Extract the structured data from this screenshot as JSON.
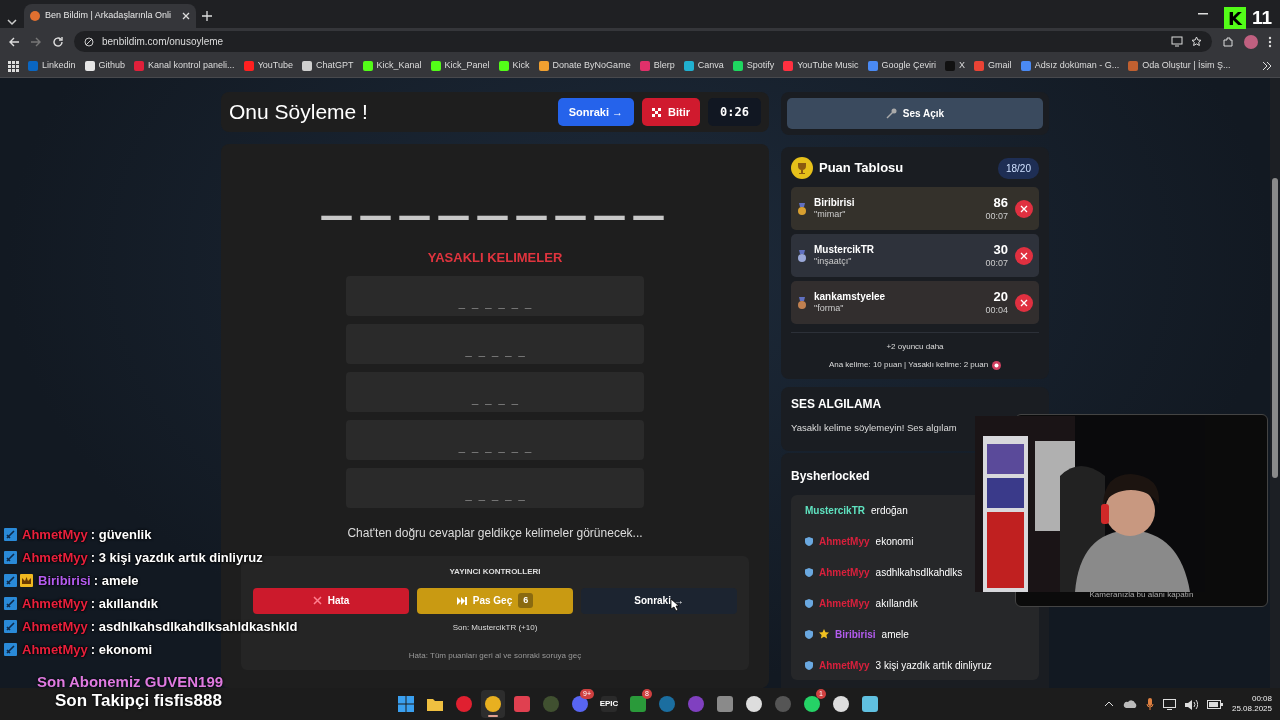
{
  "browser": {
    "tab": {
      "title": "Ben Bildim | Arkadaşlarınla Onli",
      "selected": true
    },
    "url": "benbildim.com/onusoyleme",
    "bookmarks": [
      {
        "label": "Linkedin",
        "color": "#0a66c2"
      },
      {
        "label": "Github",
        "color": "#e6e6e6"
      },
      {
        "label": "Kanal kontrol paneli...",
        "color": "#e0203a"
      },
      {
        "label": "YouTube",
        "color": "#ff2020"
      },
      {
        "label": "ChatGPT",
        "color": "#cfcfcf"
      },
      {
        "label": "Kick_Kanal",
        "color": "#53fc18"
      },
      {
        "label": "Kick_Panel",
        "color": "#53fc18"
      },
      {
        "label": "Kick",
        "color": "#53fc18"
      },
      {
        "label": "Donate ByNoGame",
        "color": "#f0a030"
      },
      {
        "label": "Blerp",
        "color": "#e0306a"
      },
      {
        "label": "Canva",
        "color": "#20b0d0"
      },
      {
        "label": "Spotify",
        "color": "#1ed760"
      },
      {
        "label": "YouTube Music",
        "color": "#ff3040"
      },
      {
        "label": "Google Çeviri",
        "color": "#4a8af4"
      },
      {
        "label": "X",
        "color": "#111111"
      },
      {
        "label": "Gmail",
        "color": "#ea4335"
      },
      {
        "label": "Adsız doküman - G...",
        "color": "#4a8af4"
      },
      {
        "label": "Oda Oluştur | İsim Ş...",
        "color": "#c06030"
      }
    ]
  },
  "kick_widget": {
    "logo": "K",
    "count": "11"
  },
  "game": {
    "title": "Onu Söyleme !",
    "next_button": "Sonraki →",
    "end_button": "Bitir",
    "timer": "0:26",
    "word_mask": "—————————",
    "banned_title": "YASAKLI KELIMELER",
    "banned_words": [
      "_ _ _ _ _ _",
      "_ _ _ _ _",
      "_ _ _ _",
      "_ _ _ _ _ _",
      "_ _ _ _ _"
    ],
    "hint": "Chat'ten doğru cevaplar geldikçe kelimeler görünecek...",
    "controls": {
      "title": "YAYINCI KONTROLLERI",
      "error_button": "Hata",
      "pass_button": "Pas Geç",
      "pass_count": "6",
      "next_button": "Sonraki →",
      "last": "Son: MustercikTR (+10)",
      "note": "Hata: Tüm puanları geri al ve sonraki soruya geç"
    }
  },
  "sound_button": "Ses Açık",
  "scoreboard": {
    "title": "Puan Tablosu",
    "round": "18/20",
    "players": [
      {
        "name": "Biribirisi",
        "answer": "\"mimar\"",
        "score": "86",
        "time": "00:07",
        "color": "#d9a030"
      },
      {
        "name": "MustercikTR",
        "answer": "\"inşaatçı\"",
        "score": "30",
        "time": "00:07",
        "color": "#9aa8d8"
      },
      {
        "name": "kankamstyelee",
        "answer": "\"forma\"",
        "score": "20",
        "time": "00:04",
        "color": "#c08050"
      }
    ],
    "more": "+2 oyuncu daha",
    "rules": "Ana kelime: 10 puan | Yasaklı kelime: 2 puan"
  },
  "voice": {
    "title": "SES ALGILAMA",
    "text": "Yasaklı kelime söylemeyin! Ses algılam"
  },
  "chat_panel": {
    "title": "Bysherlocked",
    "messages": [
      {
        "user": "MustercikTR",
        "text": "erdoğan",
        "color": "#5fe3c0",
        "shield": false,
        "star": false
      },
      {
        "user": "AhmetMyy",
        "text": "ekonomi",
        "color": "#d8203c",
        "shield": true,
        "star": false
      },
      {
        "user": "AhmetMyy",
        "text": "asdhlkahsdlkahdlks",
        "color": "#d8203c",
        "shield": true,
        "star": false
      },
      {
        "user": "AhmetMyy",
        "text": "akıllandık",
        "color": "#d8203c",
        "shield": true,
        "star": false
      },
      {
        "user": "Biribirisi",
        "text": "amele",
        "color": "#b45cf0",
        "shield": true,
        "star": true
      },
      {
        "user": "AhmetMyy",
        "text": "3 kişi yazdık artık dinliyruz",
        "color": "#d8203c",
        "shield": true,
        "star": false
      }
    ]
  },
  "stream_overlay": {
    "chat": [
      {
        "user": "AhmetMyy",
        "text": ": güvenlik",
        "color": "#e8203c",
        "crown": false
      },
      {
        "user": "AhmetMyy",
        "text": ": 3 kişi yazdık artık dinliyruz",
        "color": "#e8203c",
        "crown": false
      },
      {
        "user": "Biribirisi",
        "text": ": amele",
        "color": "#b45cf0",
        "crown": true
      },
      {
        "user": "AhmetMyy",
        "text": ": akıllandık",
        "color": "#e8203c",
        "crown": false
      },
      {
        "user": "AhmetMyy",
        "text": ": asdhlkahsdlkahdlksahldkashkld",
        "color": "#e8203c",
        "crown": false
      },
      {
        "user": "AhmetMyy",
        "text": ": ekonomi",
        "color": "#e8203c",
        "crown": false
      }
    ],
    "last_sub": "Son Abonemiz GUVEN199",
    "last_follower": "Son Takipçi fisfis888"
  },
  "webcam": {
    "kind": "picture",
    "caption": "Kameranızla bu alanı kapatın"
  },
  "taskbar": {
    "apps": [
      {
        "kind": "start",
        "color": "#3aa0f0"
      },
      {
        "kind": "folder",
        "color": "#f0c040"
      },
      {
        "kind": "round",
        "color": "#e02030"
      },
      {
        "kind": "round",
        "color": "#e8b020",
        "active": true
      },
      {
        "kind": "tile",
        "color": "#e04050"
      },
      {
        "kind": "round",
        "color": "#405030"
      },
      {
        "kind": "round",
        "color": "#5865f2",
        "badge": "9+"
      },
      {
        "kind": "tile",
        "color": "#2a2a2a",
        "label": "EPIC"
      },
      {
        "kind": "tile",
        "color": "#2a9a3a",
        "badge": "8"
      },
      {
        "kind": "round",
        "color": "#1b6ea0"
      },
      {
        "kind": "round",
        "color": "#8040c0"
      },
      {
        "kind": "tile",
        "color": "#8a8a8a"
      },
      {
        "kind": "round",
        "color": "#dddddd"
      },
      {
        "kind": "round",
        "color": "#555555"
      },
      {
        "kind": "round",
        "color": "#25d366",
        "badge": "1"
      },
      {
        "kind": "round",
        "color": "#dddddd"
      },
      {
        "kind": "tile",
        "color": "#60c0e0"
      }
    ],
    "clock": "00:08",
    "date": "25.08.2025"
  }
}
